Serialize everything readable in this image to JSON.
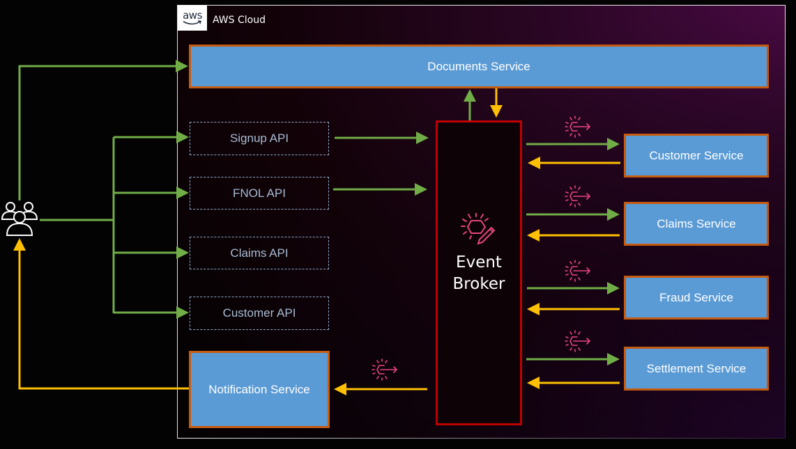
{
  "cloud": {
    "logo_text": "aws",
    "title": "AWS Cloud"
  },
  "actors": {
    "users_icon": "users-group-icon"
  },
  "services": {
    "documents": "Documents Service",
    "notification": "Notification Service",
    "customer": "Customer Service",
    "claims": "Claims Service",
    "fraud": "Fraud Service",
    "settlement": "Settlement Service"
  },
  "apis": {
    "signup": "Signup API",
    "fnol": "FNOL API",
    "claims": "Claims API",
    "customer": "Customer API"
  },
  "broker": {
    "line1": "Event",
    "line2": "Broker",
    "icon": "event-broker-icon"
  },
  "event_icon": "eventbridge-rule-icon",
  "colors": {
    "request_arrow": "#70ad47",
    "response_arrow": "#ffc000",
    "service_fill": "#5b9bd5",
    "service_border": "#c55a11",
    "broker_border": "#c00000",
    "icon_pink": "#e7457f",
    "api_border": "#8ea9c8"
  }
}
